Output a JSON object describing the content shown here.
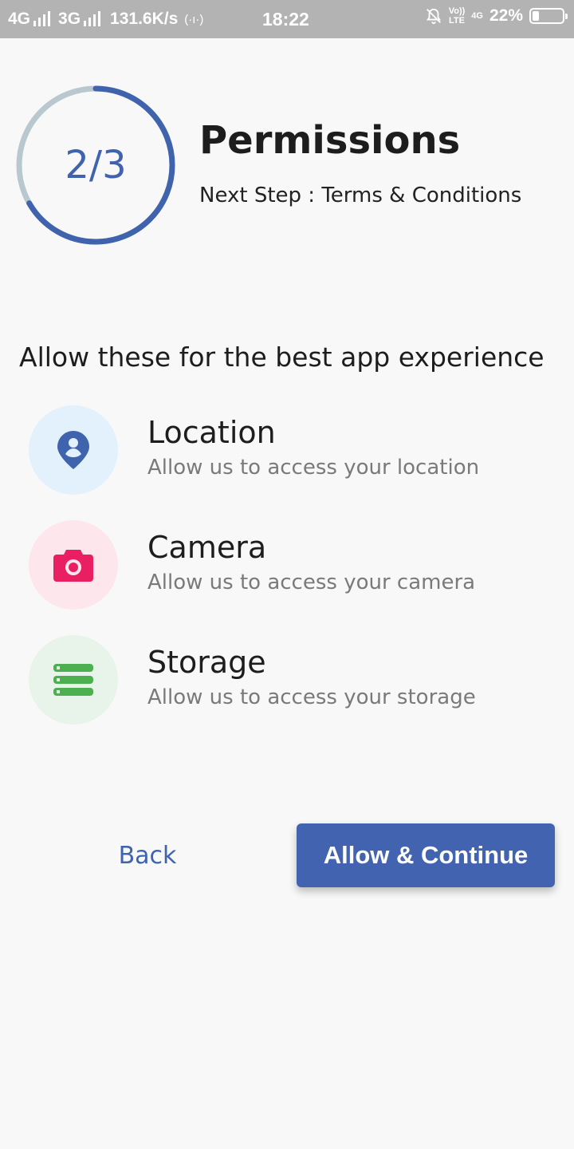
{
  "status_bar": {
    "net1": "4G",
    "net2": "3G",
    "speed": "131.6K/s",
    "hotspot": "(·ı·)",
    "time": "18:22",
    "volte_top": "Vo))",
    "volte_bottom": "LTE",
    "net_right": "4G",
    "battery_percent": "22%",
    "battery_level": 0.22
  },
  "header": {
    "progress_text": "2/3",
    "progress_fraction": 0.667,
    "title": "Permissions",
    "subtitle": "Next Step : Terms & Conditions"
  },
  "intro": "Allow these for the best app experience",
  "permissions": [
    {
      "name": "Location",
      "description": "Allow us to access your location",
      "icon": "location-pin-icon",
      "color": "#3f63ad",
      "bg": "#e3f1fd"
    },
    {
      "name": "Camera",
      "description": "Allow us to access your camera",
      "icon": "camera-icon",
      "color": "#e91e63",
      "bg": "#fde6ec"
    },
    {
      "name": "Storage",
      "description": "Allow us to access your storage",
      "icon": "storage-icon",
      "color": "#4caf50",
      "bg": "#e8f4e9"
    }
  ],
  "actions": {
    "back": "Back",
    "continue": "Allow & Continue"
  },
  "colors": {
    "accent": "#4264b0",
    "ring_track": "#b9c7cf"
  }
}
